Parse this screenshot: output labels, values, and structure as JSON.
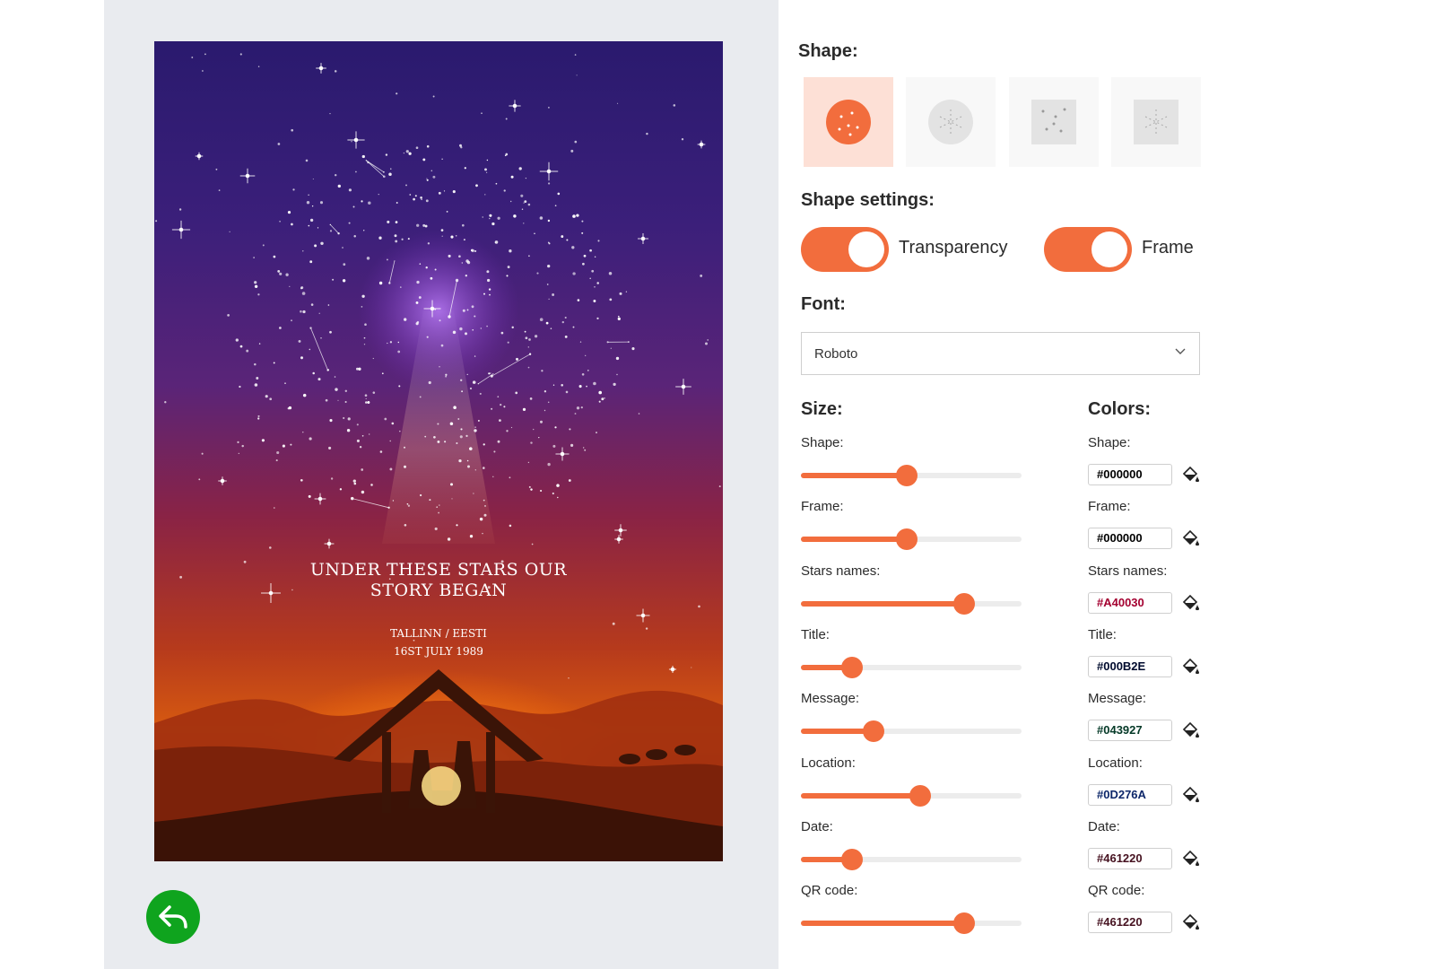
{
  "poster": {
    "title_line1": "UNDER THESE STARS OUR",
    "title_line2": "STORY BEGAN",
    "location": "TALLINN / EESTI",
    "date": "16ST JULY 1989"
  },
  "shape_section": {
    "label": "Shape:",
    "options": [
      {
        "name": "circle-filled",
        "selected": true
      },
      {
        "name": "circle-outline",
        "selected": false
      },
      {
        "name": "square-dots",
        "selected": false
      },
      {
        "name": "square-lines",
        "selected": false
      }
    ]
  },
  "shape_settings": {
    "label": "Shape settings:",
    "transparency": {
      "label": "Transparency",
      "on": true
    },
    "frame": {
      "label": "Frame",
      "on": true
    }
  },
  "font": {
    "label": "Font:",
    "selected": "Roboto"
  },
  "size": {
    "label": "Size:",
    "sliders": [
      {
        "label": "Shape:",
        "value": 0.48
      },
      {
        "label": "Frame:",
        "value": 0.48
      },
      {
        "label": "Stars names:",
        "value": 0.74
      },
      {
        "label": "Title:",
        "value": 0.23
      },
      {
        "label": "Message:",
        "value": 0.33
      },
      {
        "label": "Location:",
        "value": 0.54
      },
      {
        "label": "Date:",
        "value": 0.23
      },
      {
        "label": "QR code:",
        "value": 0.74
      }
    ]
  },
  "colors": {
    "label": "Colors:",
    "items": [
      {
        "label": "Shape:",
        "value": "#000000",
        "color": "#000000"
      },
      {
        "label": "Frame:",
        "value": "#000000",
        "color": "#000000"
      },
      {
        "label": "Stars names:",
        "value": "#A40030",
        "color": "#A40030"
      },
      {
        "label": "Title:",
        "value": "#000B2E",
        "color": "#000B2E"
      },
      {
        "label": "Message:",
        "value": "#043927",
        "color": "#043927"
      },
      {
        "label": "Location:",
        "value": "#0D276A",
        "color": "#0D276A"
      },
      {
        "label": "Date:",
        "value": "#461220",
        "color": "#461220"
      },
      {
        "label": "QR code:",
        "value": "#461220",
        "color": "#461220"
      }
    ]
  },
  "accent_color": "#F26D3D"
}
